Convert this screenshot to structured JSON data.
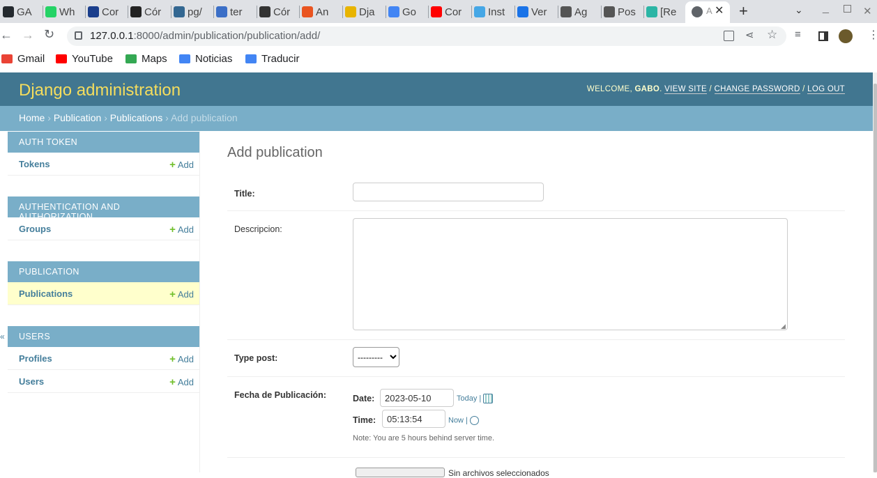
{
  "browser": {
    "tabs": [
      {
        "label": "GA",
        "icon": "github-icon",
        "color": "#24292e"
      },
      {
        "label": "Wh",
        "icon": "whatsapp-icon",
        "color": "#25d366"
      },
      {
        "label": "Cor",
        "icon": "bookmark-icon",
        "color": "#1a3e8c"
      },
      {
        "label": "Cór",
        "icon": "linux-icon",
        "color": "#222"
      },
      {
        "label": "pg/",
        "icon": "pg-icon",
        "color": "#336791"
      },
      {
        "label": "ter",
        "icon": "terminal-icon",
        "color": "#3b6fc7"
      },
      {
        "label": "Cór",
        "icon": "codecademy-icon",
        "color": "#333"
      },
      {
        "label": "An",
        "icon": "ubuntu-icon",
        "color": "#e95420"
      },
      {
        "label": "Dja",
        "icon": "user-icon",
        "color": "#e8b400"
      },
      {
        "label": "Go",
        "icon": "translate-icon",
        "color": "#4285f4"
      },
      {
        "label": "Cor",
        "icon": "youtube-icon",
        "color": "#ff0000"
      },
      {
        "label": "Inst",
        "icon": "flutter-icon",
        "color": "#45a7e6"
      },
      {
        "label": "Ver",
        "icon": "refresh-icon",
        "color": "#1a73e8"
      },
      {
        "label": "Ag",
        "icon": "person-icon",
        "color": "#555"
      },
      {
        "label": "Pos",
        "icon": "person-icon",
        "color": "#555"
      },
      {
        "label": "[Re",
        "icon": "chat-icon",
        "color": "#2bb5a5"
      }
    ],
    "active_tab_label": "A",
    "new_tab": "+",
    "url_host": "127.0.0.1",
    "url_path": ":8000/admin/publication/publication/add/",
    "bookmarks": [
      {
        "label": "Gmail",
        "icon": "gmail-icon"
      },
      {
        "label": "YouTube",
        "icon": "youtube-icon"
      },
      {
        "label": "Maps",
        "icon": "maps-icon"
      },
      {
        "label": "Noticias",
        "icon": "news-icon"
      },
      {
        "label": "Traducir",
        "icon": "translate-icon"
      }
    ]
  },
  "header": {
    "brand": "Django administration",
    "welcome": "WELCOME,",
    "user": "GABO",
    "view_site": "VIEW SITE",
    "change_password": "CHANGE PASSWORD",
    "log_out": "LOG OUT",
    "sep": "/"
  },
  "breadcrumbs": {
    "home": "Home",
    "app": "Publication",
    "model": "Publications",
    "current": "Add publication",
    "sep": "›"
  },
  "sidebar": {
    "add_label": "Add",
    "modules": [
      {
        "caption": "AUTH TOKEN",
        "rows": [
          "Tokens"
        ]
      },
      {
        "caption": "AUTHENTICATION AND AUTHORIZATION",
        "rows": [
          "Groups"
        ]
      },
      {
        "caption": "PUBLICATION",
        "rows": [
          "Publications"
        ]
      },
      {
        "caption": "USERS",
        "rows": [
          "Profiles",
          "Users"
        ]
      }
    ],
    "collapse_glyph": "«"
  },
  "form": {
    "title": "Add publication",
    "title_label": "Title:",
    "title_value": "",
    "descripcion_label": "Descripcion:",
    "type_post_label": "Type post:",
    "type_post_value": "---------",
    "fecha_label": "Fecha de Publicación:",
    "date_label": "Date:",
    "date_value": "2023-05-10",
    "today_label": "Today",
    "time_label": "Time:",
    "time_value": "05:13:54",
    "now_label": "Now",
    "shortcut_sep": "|",
    "note": "Note: You are 5 hours behind server time.",
    "file_hint": "Sin archivos seleccionados"
  },
  "colors": {
    "header_bg": "#417690",
    "brand": "#f5dd5d",
    "breadcrumb_bg": "#79aec8",
    "link": "#447e9b",
    "add_plus": "#70bf2b",
    "selected_row": "#ffffcc"
  }
}
